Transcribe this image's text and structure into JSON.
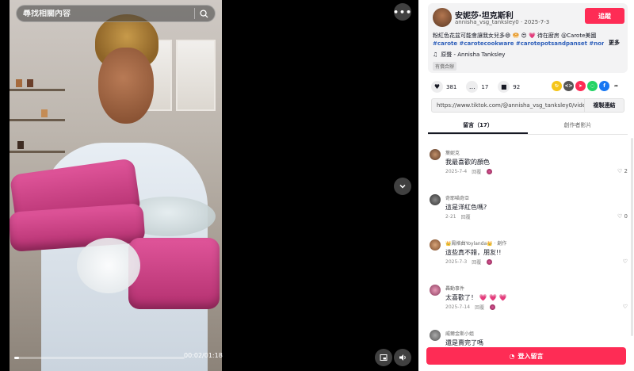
{
  "video": {
    "search_placeholder": "尋找相關內容",
    "time": "00:02/01:18",
    "progress": 0.03
  },
  "author": {
    "name": "安妮莎·坦克斯利",
    "sub": "annisha_vsg_tanksley0 · 2025-7-3",
    "follow_label": "追蹤",
    "caption": "粉紅色花盆可能會讓我女兒多😄 🥯 😍 💗 待在廚房 @Carote美國",
    "tags": "#carote #carotecookware #carotepotsandpanset #nonstick...",
    "more_label": "更多",
    "music": "原聲 - Annisha Tanksley",
    "label_chip": "有償合辦"
  },
  "stats": {
    "likes": "381",
    "comments": "17",
    "saves": "92"
  },
  "share": {
    "url": "https://www.tiktok.com/@annisha_vsg_tanksley0/video/...",
    "copy_label": "複製連結"
  },
  "tabs": {
    "comments": "留言（17）",
    "creator_videos": "創作者影片"
  },
  "comments": [
    {
      "user": "葉妮克",
      "text": "我最喜歡的顏色",
      "date": "2025-7-4",
      "reply": "回覆",
      "likes": "2"
    },
    {
      "user": "奇耶喵奇亞",
      "text": "這是洋紅色嗎?",
      "date": "2-21",
      "reply": "回覆",
      "likes": "0"
    },
    {
      "user": "👑鳳格曲Yoylanda👑 · 創作",
      "text": "這些真不錯，朋友!!",
      "date": "2025-7-3",
      "reply": "回覆",
      "likes": ""
    },
    {
      "user": "轟動事件",
      "text": "太喜歡了！ 💗 💗 💗",
      "date": "2025-7-14",
      "reply": "回覆",
      "likes": ""
    },
    {
      "user": "威爾金斯小姐",
      "text": "還是賣完了嗎",
      "date": "",
      "reply": "",
      "likes": ""
    }
  ],
  "login_label": "登入留言",
  "colors": {
    "accent": "#fe2c55",
    "tag": "#2b5db9"
  }
}
